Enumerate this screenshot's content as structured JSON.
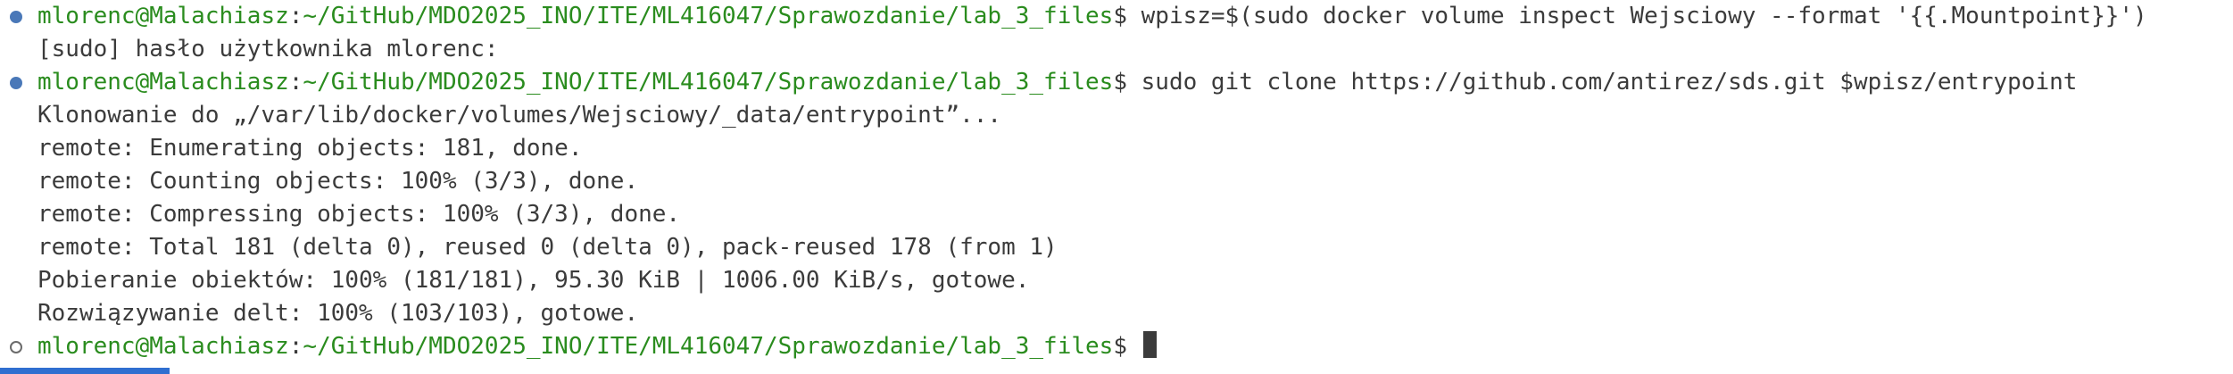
{
  "colors": {
    "prompt_user": "#2a8c1e",
    "prompt_path": "#2a8c1e",
    "text": "#3b3b3b",
    "marker_filled": "#4a78b8",
    "accent_bar": "#2f6fd0"
  },
  "prompt": {
    "user_host": "mlorenc@Malachiasz",
    "separator": ":",
    "path": "~/GitHub/MDO2025_INO/ITE/ML416047/Sprawozdanie/lab_3_files",
    "symbol": "$"
  },
  "commands": {
    "cmd1": " wpisz=$(sudo docker volume inspect Wejsciowy --format '{{.Mountpoint}}')",
    "cmd2": " sudo git clone https://github.com/antirez/sds.git $wpisz/entrypoint",
    "cmd3": " "
  },
  "output": {
    "sudo_prompt": "[sudo] hasło użytkownika mlorenc:",
    "clone_lines": [
      "Klonowanie do „/var/lib/docker/volumes/Wejsciowy/_data/entrypoint”...",
      "remote: Enumerating objects: 181, done.",
      "remote: Counting objects: 100% (3/3), done.",
      "remote: Compressing objects: 100% (3/3), done.",
      "remote: Total 181 (delta 0), reused 0 (delta 0), pack-reused 178 (from 1)",
      "Pobieranie obiektów: 100% (181/181), 95.30 KiB | 1006.00 KiB/s, gotowe.",
      "Rozwiązywanie delt: 100% (103/103), gotowe."
    ]
  },
  "icons": {
    "marker_done": "command-decoration-success-icon",
    "marker_pending": "command-decoration-empty-icon",
    "cursor": "terminal-cursor-block"
  }
}
